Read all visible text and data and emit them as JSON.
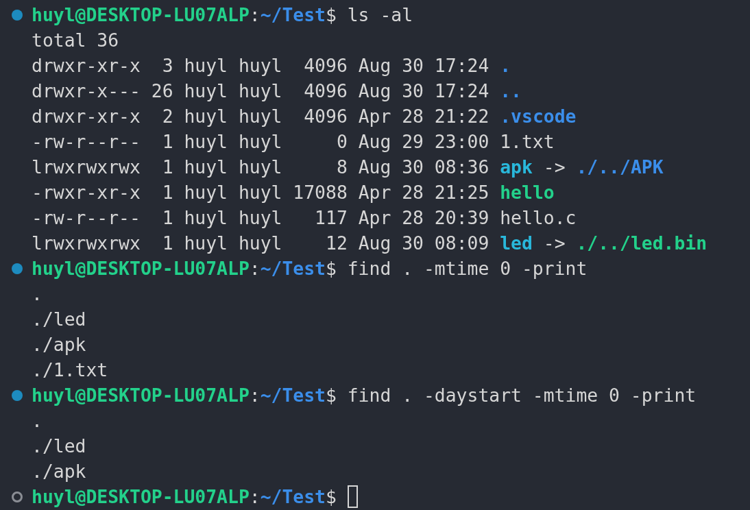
{
  "blocks": [
    {
      "succeeded": true,
      "prompt": {
        "user_host": "huyl@DESKTOP-LU07ALP",
        "separator": ":",
        "path": "~/Test",
        "symbol": "$"
      },
      "command": "ls -al",
      "output": [
        [
          {
            "kind": "plain",
            "text": "total 36"
          }
        ],
        [
          {
            "kind": "plain",
            "text": "drwxr-xr-x  3 huyl huyl  4096 Aug 30 17:24 "
          },
          {
            "kind": "dir",
            "text": "."
          }
        ],
        [
          {
            "kind": "plain",
            "text": "drwxr-x--- 26 huyl huyl  4096 Aug 30 17:24 "
          },
          {
            "kind": "dir",
            "text": ".."
          }
        ],
        [
          {
            "kind": "plain",
            "text": "drwxr-xr-x  2 huyl huyl  4096 Apr 28 21:22 "
          },
          {
            "kind": "dir",
            "text": ".vscode"
          }
        ],
        [
          {
            "kind": "plain",
            "text": "-rw-r--r--  1 huyl huyl     0 Aug 29 23:00 1.txt"
          }
        ],
        [
          {
            "kind": "plain",
            "text": "lrwxrwxrwx  1 huyl huyl     8 Aug 30 08:36 "
          },
          {
            "kind": "link",
            "text": "apk"
          },
          {
            "kind": "plain",
            "text": " -> "
          },
          {
            "kind": "dir",
            "text": "./../APK"
          }
        ],
        [
          {
            "kind": "plain",
            "text": "-rwxr-xr-x  1 huyl huyl 17088 Apr 28 21:25 "
          },
          {
            "kind": "exec",
            "text": "hello"
          }
        ],
        [
          {
            "kind": "plain",
            "text": "-rw-r--r--  1 huyl huyl   117 Apr 28 20:39 hello.c"
          }
        ],
        [
          {
            "kind": "plain",
            "text": "lrwxrwxrwx  1 huyl huyl    12 Aug 30 08:09 "
          },
          {
            "kind": "link",
            "text": "led"
          },
          {
            "kind": "plain",
            "text": " -> "
          },
          {
            "kind": "exec",
            "text": "./../led.bin"
          }
        ]
      ]
    },
    {
      "succeeded": true,
      "prompt": {
        "user_host": "huyl@DESKTOP-LU07ALP",
        "separator": ":",
        "path": "~/Test",
        "symbol": "$"
      },
      "command": "find . -mtime 0 -print",
      "output": [
        [
          {
            "kind": "plain",
            "text": "."
          }
        ],
        [
          {
            "kind": "plain",
            "text": "./led"
          }
        ],
        [
          {
            "kind": "plain",
            "text": "./apk"
          }
        ],
        [
          {
            "kind": "plain",
            "text": "./1.txt"
          }
        ]
      ]
    },
    {
      "succeeded": true,
      "prompt": {
        "user_host": "huyl@DESKTOP-LU07ALP",
        "separator": ":",
        "path": "~/Test",
        "symbol": "$"
      },
      "command": "find . -daystart -mtime 0 -print",
      "output": [
        [
          {
            "kind": "plain",
            "text": "."
          }
        ],
        [
          {
            "kind": "plain",
            "text": "./led"
          }
        ],
        [
          {
            "kind": "plain",
            "text": "./apk"
          }
        ]
      ]
    },
    {
      "succeeded": false,
      "prompt": {
        "user_host": "huyl@DESKTOP-LU07ALP",
        "separator": ":",
        "path": "~/Test",
        "symbol": "$"
      },
      "cursor": true
    }
  ]
}
